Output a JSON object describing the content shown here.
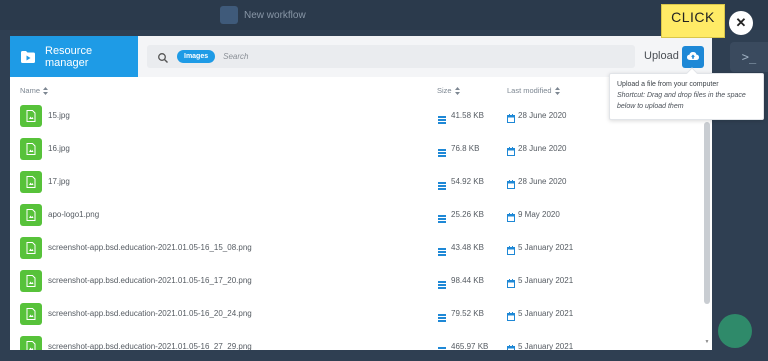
{
  "background": {
    "workflow_label": "New workflow",
    "terminal_glyph": ">_"
  },
  "header": {
    "title": "Resource manager",
    "filter_chip": "Images",
    "search_placeholder": "Search",
    "upload_label": "Upload"
  },
  "columns": {
    "name": "Name",
    "size": "Size",
    "modified": "Last modified"
  },
  "files": [
    {
      "name": "15.jpg",
      "size": "41.58 KB",
      "modified": "28 June 2020"
    },
    {
      "name": "16.jpg",
      "size": "76.8 KB",
      "modified": "28 June 2020"
    },
    {
      "name": "17.jpg",
      "size": "54.92 KB",
      "modified": "28 June 2020"
    },
    {
      "name": "apo-logo1.png",
      "size": "25.26 KB",
      "modified": "9 May 2020"
    },
    {
      "name": "screenshot-app.bsd.education-2021.01.05-16_15_08.png",
      "size": "43.48 KB",
      "modified": "5 January 2021"
    },
    {
      "name": "screenshot-app.bsd.education-2021.01.05-16_17_20.png",
      "size": "98.44 KB",
      "modified": "5 January 2021"
    },
    {
      "name": "screenshot-app.bsd.education-2021.01.05-16_20_24.png",
      "size": "79.52 KB",
      "modified": "5 January 2021"
    },
    {
      "name": "screenshot-app.bsd.education-2021.01.05-16_27_29.png",
      "size": "465.97 KB",
      "modified": "5 January 2021"
    }
  ],
  "tooltip": {
    "line1": "Upload a file from your computer",
    "hint": "Shortcut: Drag and drop files in the space below to upload them"
  },
  "callout": {
    "text": "CLICK"
  },
  "close": {
    "glyph": "✕"
  },
  "colors": {
    "accent": "#1e9be6",
    "file_icon": "#57c23a",
    "callout": "#ffeb66"
  }
}
